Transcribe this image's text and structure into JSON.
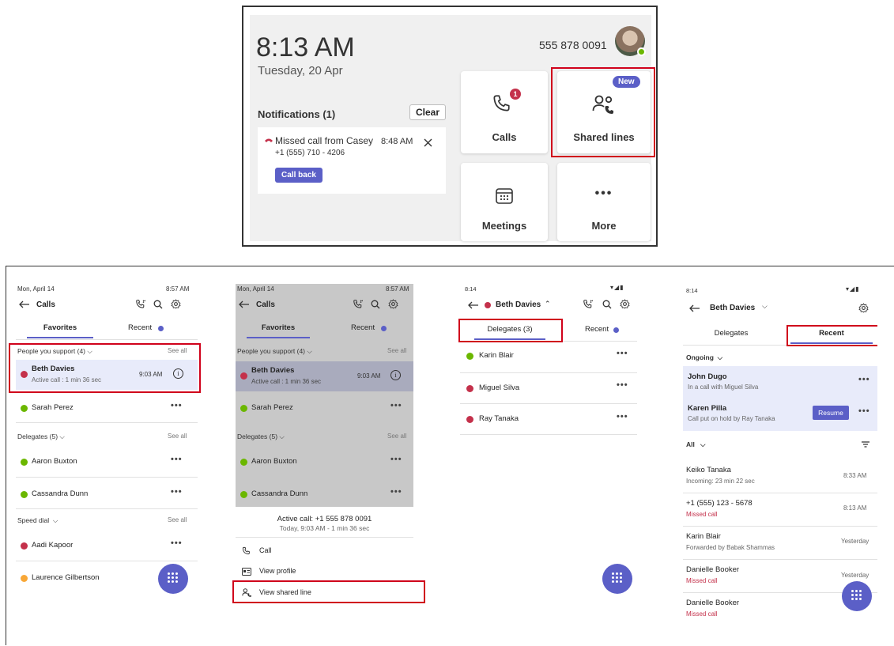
{
  "top": {
    "time": "8:13 AM",
    "date": "Tuesday, 20 Apr",
    "phone_number": "555 878 0091",
    "notifications_header": "Notifications (1)",
    "clear_label": "Clear",
    "notification": {
      "title": "Missed call from Casey",
      "number": "+1 (555) 710 - 4206",
      "time": "8:48 AM",
      "call_back_label": "Call back"
    },
    "tiles": {
      "calls": {
        "label": "Calls",
        "badge": "1"
      },
      "shared_lines": {
        "label": "Shared lines",
        "badge": "New"
      },
      "meetings": {
        "label": "Meetings"
      },
      "more": {
        "label": "More",
        "glyph": "•••"
      }
    }
  },
  "screen1": {
    "date": "Mon, April 14",
    "time": "8:57 AM",
    "title": "Calls",
    "tabs": [
      "Favorites",
      "Recent"
    ],
    "section_support": "People you support (4)",
    "see_all": "See all",
    "beth": {
      "name": "Beth Davies",
      "status": "Active call : 1 min 36 sec",
      "time": "9:03 AM"
    },
    "sarah": "Sarah Perez",
    "section_delegates": "Delegates (5)",
    "aaron": "Aaron Buxton",
    "cassandra": "Cassandra Dunn",
    "section_speed": "Speed dial",
    "aadi": "Aadi Kapoor",
    "laurence": "Laurence Gilbertson",
    "more_glyph": "•••"
  },
  "screen2": {
    "date": "Mon, April 14",
    "time": "8:57 AM",
    "title": "Calls",
    "tabs": [
      "Favorites",
      "Recent"
    ],
    "section_support": "People you support (4)",
    "see_all": "See all",
    "beth": {
      "name": "Beth Davies",
      "status": "Active call : 1 min 36 sec",
      "time": "9:03 AM"
    },
    "sarah": "Sarah Perez",
    "section_delegates": "Delegates (5)",
    "aaron": "Aaron Buxton",
    "cassandra": "Cassandra Dunn",
    "sheet": {
      "title": "Active call: +1 555 878 0091",
      "subtitle": "Today, 9:03 AM - 1 min 36 sec",
      "call": "Call",
      "view_profile": "View profile",
      "view_shared_line": "View shared line"
    },
    "more_glyph": "•••"
  },
  "screen3": {
    "time": "8:14",
    "title": "Beth Davies",
    "tabs": [
      "Delegates (3)",
      "Recent"
    ],
    "rows": [
      "Karin Blair",
      "Miguel Silva",
      "Ray Tanaka"
    ],
    "more_glyph": "•••"
  },
  "screen4": {
    "time": "8:14",
    "title": "Beth Davies",
    "tabs": [
      "Delegates",
      "Recent"
    ],
    "ongoing": "Ongoing",
    "john": {
      "name": "John Dugo",
      "sub": "In a call with Miguel Silva"
    },
    "karen": {
      "name": "Karen Pilla",
      "sub": "Call put on hold by Ray Tanaka",
      "resume": "Resume"
    },
    "filter": "All",
    "recent": [
      {
        "name": "Keiko Tanaka",
        "sub": "Incoming: 23 min 22 sec",
        "time": "8:33 AM",
        "missed": false
      },
      {
        "name": "+1 (555) 123 - 5678",
        "sub": "Missed call",
        "time": "8:13 AM",
        "missed": true
      },
      {
        "name": "Karin Blair",
        "sub": "Forwarded by Babak Shammas",
        "time": "Yesterday",
        "missed": false
      },
      {
        "name": "Danielle Booker",
        "sub": "Missed call",
        "time": "Yesterday",
        "missed": true
      },
      {
        "name": "Danielle Booker",
        "sub": "Missed call",
        "time": "",
        "missed": true
      }
    ],
    "more_glyph": "•••"
  },
  "colors": {
    "accent": "#5b5fc7",
    "available": "#6bb700",
    "busy": "#c4314b",
    "away": "#f8a737",
    "highlight": "#d0021b"
  }
}
